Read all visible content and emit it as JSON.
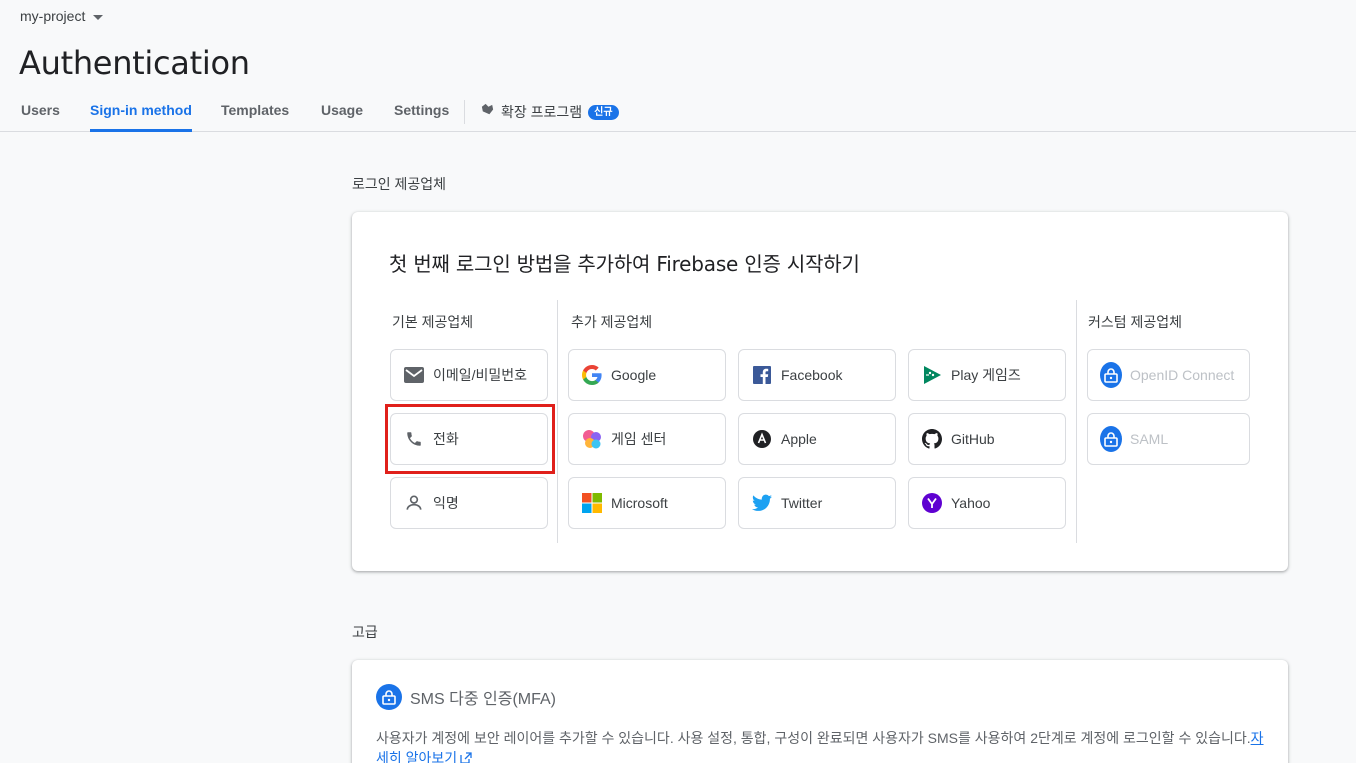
{
  "project": {
    "name": "my-project"
  },
  "page": {
    "title": "Authentication"
  },
  "tabs": [
    {
      "label": "Users"
    },
    {
      "label": "Sign-in method"
    },
    {
      "label": "Templates"
    },
    {
      "label": "Usage"
    },
    {
      "label": "Settings"
    }
  ],
  "extensions_tab": {
    "label": "확장 프로그램",
    "badge": "신규"
  },
  "providers_section": {
    "label": "로그인 제공업체",
    "card_title": "첫 번째 로그인 방법을 추가하여 Firebase 인증 시작하기",
    "native": {
      "heading": "기본 제공업체",
      "items": [
        {
          "label": "이메일/비밀번호",
          "icon": "mail-icon"
        },
        {
          "label": "전화",
          "icon": "phone-icon"
        },
        {
          "label": "익명",
          "icon": "person-icon"
        }
      ]
    },
    "additional": {
      "heading": "추가 제공업체",
      "items": [
        {
          "label": "Google",
          "icon": "google-icon"
        },
        {
          "label": "Facebook",
          "icon": "facebook-icon"
        },
        {
          "label": "Play 게임즈",
          "icon": "play-games-icon"
        },
        {
          "label": "게임 센터",
          "icon": "game-center-icon"
        },
        {
          "label": "Apple",
          "icon": "apple-icon"
        },
        {
          "label": "GitHub",
          "icon": "github-icon"
        },
        {
          "label": "Microsoft",
          "icon": "microsoft-icon"
        },
        {
          "label": "Twitter",
          "icon": "twitter-icon"
        },
        {
          "label": "Yahoo",
          "icon": "yahoo-icon"
        }
      ]
    },
    "custom": {
      "heading": "커스텀 제공업체",
      "items": [
        {
          "label": "OpenID Connect",
          "icon": "lock-icon"
        },
        {
          "label": "SAML",
          "icon": "lock-icon"
        }
      ]
    }
  },
  "advanced_section": {
    "label": "고급",
    "mfa_title": "SMS 다중 인증(MFA)",
    "mfa_description": "사용자가 계정에 보안 레이어를 추가할 수 있습니다. 사용 설정, 통합, 구성이 완료되면 사용자가 SMS를 사용하여 2단계로 계정에 로그인할 수 있습니다.",
    "learn_more": "자세히 알아보기"
  },
  "colors": {
    "accent": "#1a73e8",
    "highlight": "#e0201b",
    "background": "#f8f9fa"
  }
}
